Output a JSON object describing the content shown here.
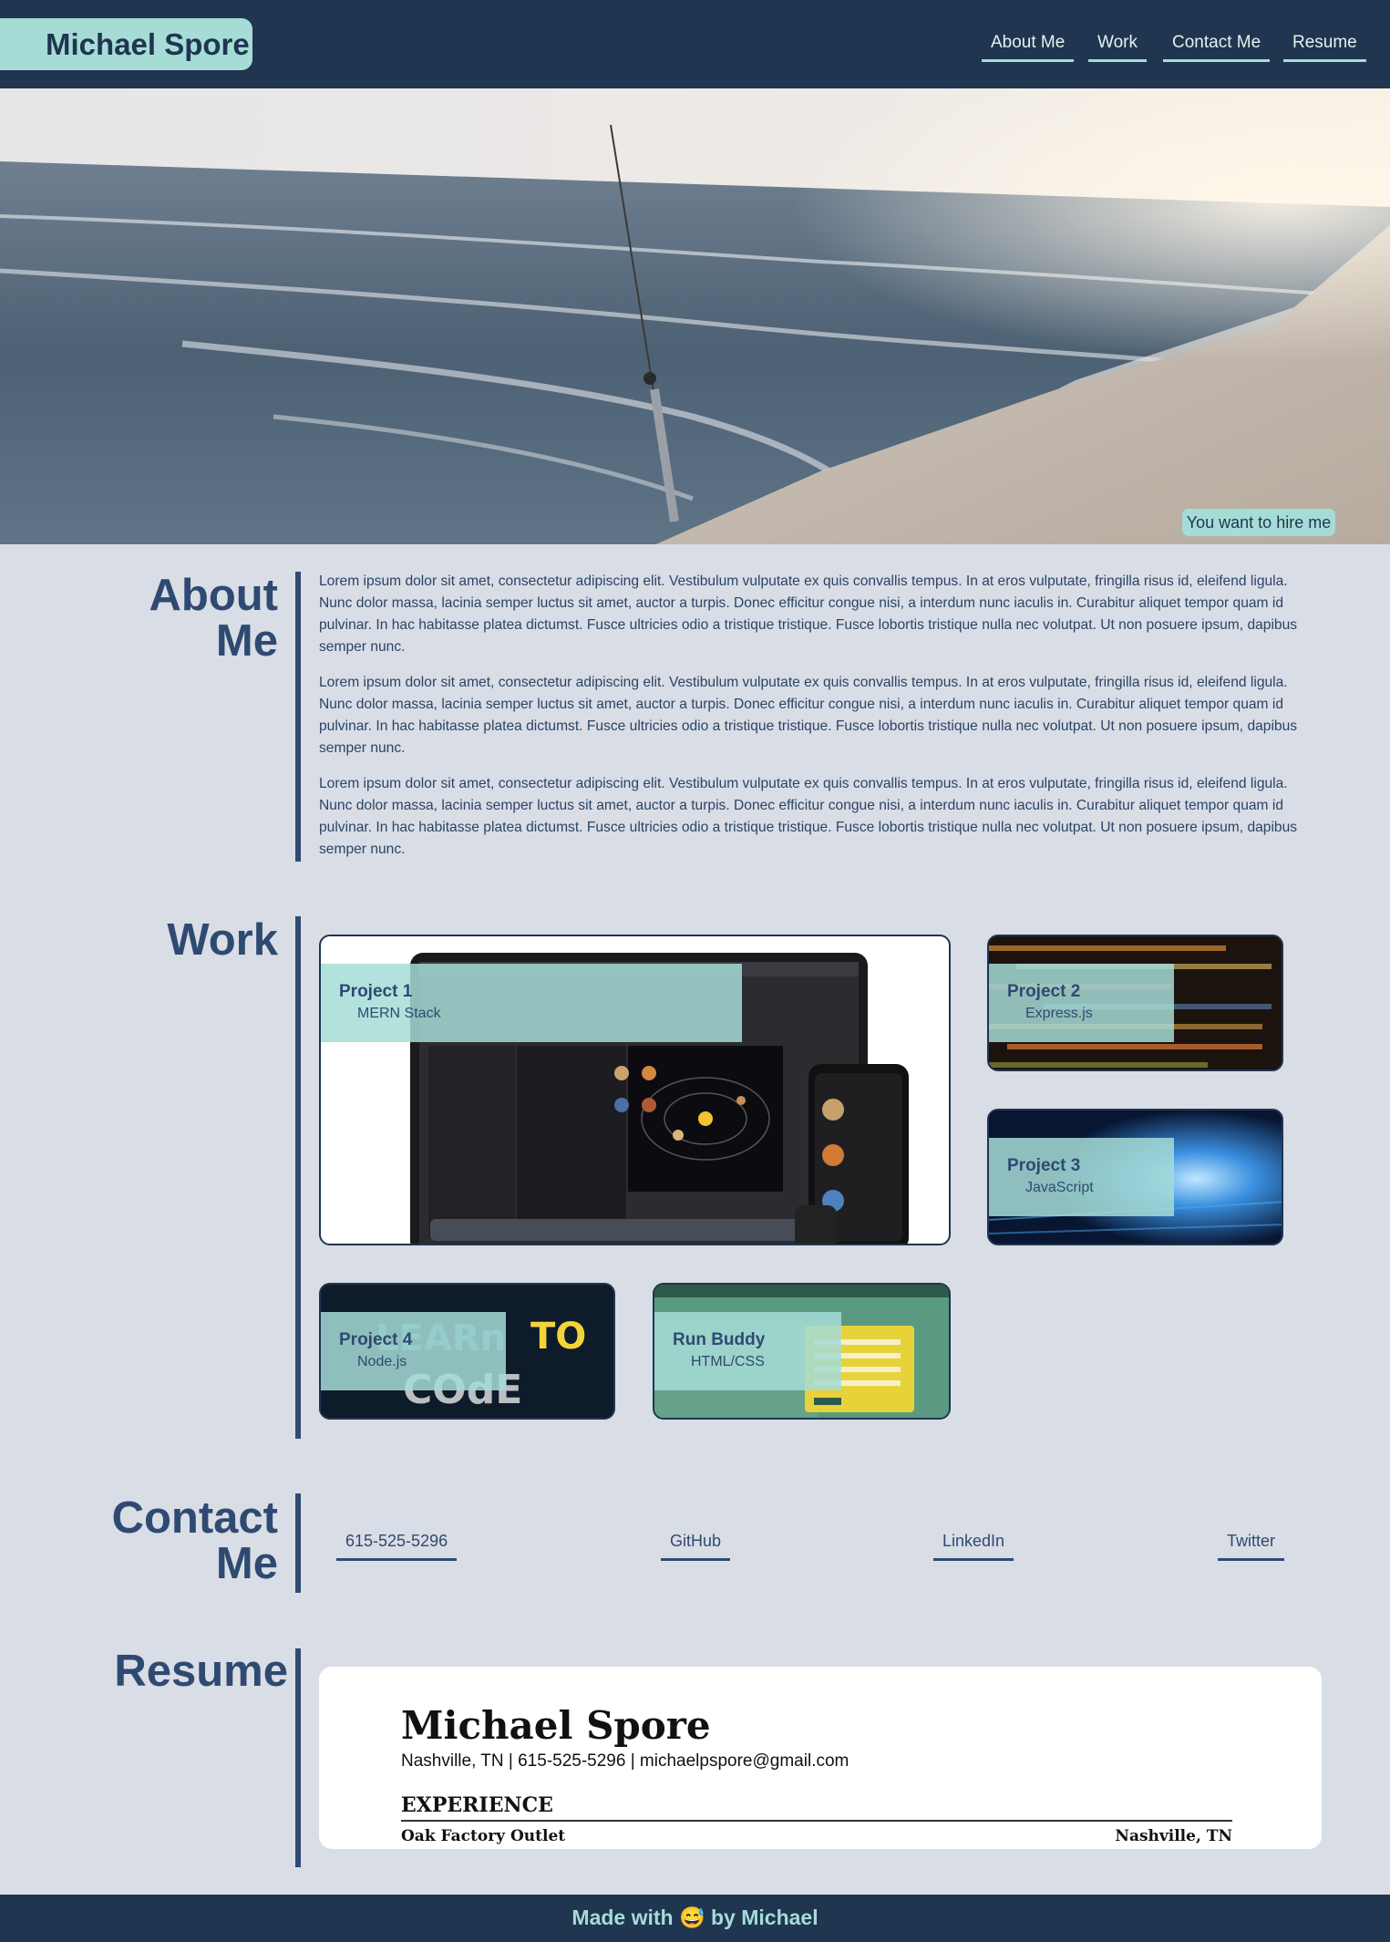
{
  "header": {
    "brand": "Michael Spore",
    "nav": [
      "About Me",
      "Work",
      "Contact Me",
      "Resume"
    ]
  },
  "hero": {
    "image": "beach-fishing-rod-photo",
    "hire_label": "You want to hire me"
  },
  "about": {
    "title_line1": "About",
    "title_line2": "Me",
    "paragraphs": [
      "Lorem ipsum dolor sit amet, consectetur adipiscing elit. Vestibulum vulputate ex quis convallis tempus. In at eros vulputate, fringilla risus id, eleifend ligula. Nunc dolor massa, lacinia semper luctus sit amet, auctor a turpis. Donec efficitur congue nisi, a interdum nunc iaculis in. Curabitur aliquet tempor quam id pulvinar. In hac habitasse platea dictumst. Fusce ultricies odio a tristique tristique. Fusce lobortis tristique nulla nec volutpat. Ut non posuere ipsum, dapibus semper nunc.",
      "Lorem ipsum dolor sit amet, consectetur adipiscing elit. Vestibulum vulputate ex quis convallis tempus. In at eros vulputate, fringilla risus id, eleifend ligula. Nunc dolor massa, lacinia semper luctus sit amet, auctor a turpis. Donec efficitur congue nisi, a interdum nunc iaculis in. Curabitur aliquet tempor quam id pulvinar. In hac habitasse platea dictumst. Fusce ultricies odio a tristique tristique. Fusce lobortis tristique nulla nec volutpat. Ut non posuere ipsum, dapibus semper nunc.",
      "Lorem ipsum dolor sit amet, consectetur adipiscing elit. Vestibulum vulputate ex quis convallis tempus. In at eros vulputate, fringilla risus id, eleifend ligula. Nunc dolor massa, lacinia semper luctus sit amet, auctor a turpis. Donec efficitur congue nisi, a interdum nunc iaculis in. Curabitur aliquet tempor quam id pulvinar. In hac habitasse platea dictumst. Fusce ultricies odio a tristique tristique. Fusce lobortis tristique nulla nec volutpat. Ut non posuere ipsum, dapibus semper nunc."
    ]
  },
  "work": {
    "title": "Work",
    "projects": [
      {
        "title": "Project 1",
        "tech": "MERN Stack"
      },
      {
        "title": "Project 2",
        "tech": "Express.js"
      },
      {
        "title": "Project 3",
        "tech": "JavaScript"
      },
      {
        "title": "Project 4",
        "tech": "Node.js"
      },
      {
        "title": "Run Buddy",
        "tech": "HTML/CSS"
      }
    ]
  },
  "contact": {
    "title_line1": "Contact",
    "title_line2": "Me",
    "links": [
      "615-525-5296",
      "GitHub",
      "LinkedIn",
      "Twitter"
    ]
  },
  "resume": {
    "title": "Resume",
    "name": "Michael Spore",
    "contact_line": "Nashville, TN | 615-525-5296 | michaelpspore@gmail.com",
    "section": "EXPERIENCE",
    "job": "Oak Factory Outlet",
    "location": "Nashville, TN"
  },
  "footer": {
    "text": "Made with 😅 by Michael"
  },
  "colors": {
    "navy": "#1f3550",
    "accent": "#a6dcd6",
    "page_bg": "#d9dde5",
    "heading": "#2f4a72"
  }
}
